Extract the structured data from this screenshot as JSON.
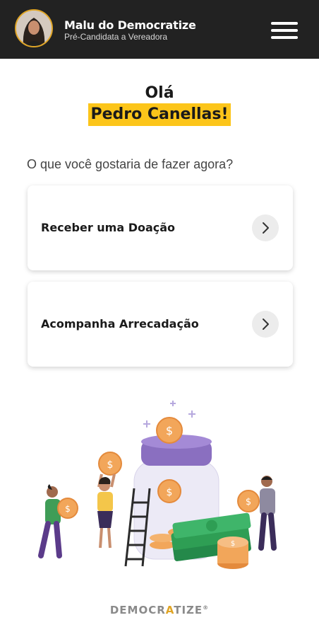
{
  "header": {
    "name": "Malu do Democratize",
    "subtitle": "Pré-Candidata a Vereadora"
  },
  "greeting": {
    "hello": "Olá",
    "user_name": "Pedro Canellas!"
  },
  "question": "O que você gostaria de fazer agora?",
  "options": [
    {
      "label": "Receber uma Doação"
    },
    {
      "label": "Acompanha Arrecadação"
    }
  ],
  "footer": {
    "brand_start": "DEMOCR",
    "brand_accent": "A",
    "brand_end": "TIZE",
    "mark": "®"
  },
  "colors": {
    "header_bg": "#222222",
    "highlight": "#fcc51a",
    "coin": "#f2a65a",
    "jar_lid": "#8a6fc0",
    "money": "#2e9e54"
  }
}
